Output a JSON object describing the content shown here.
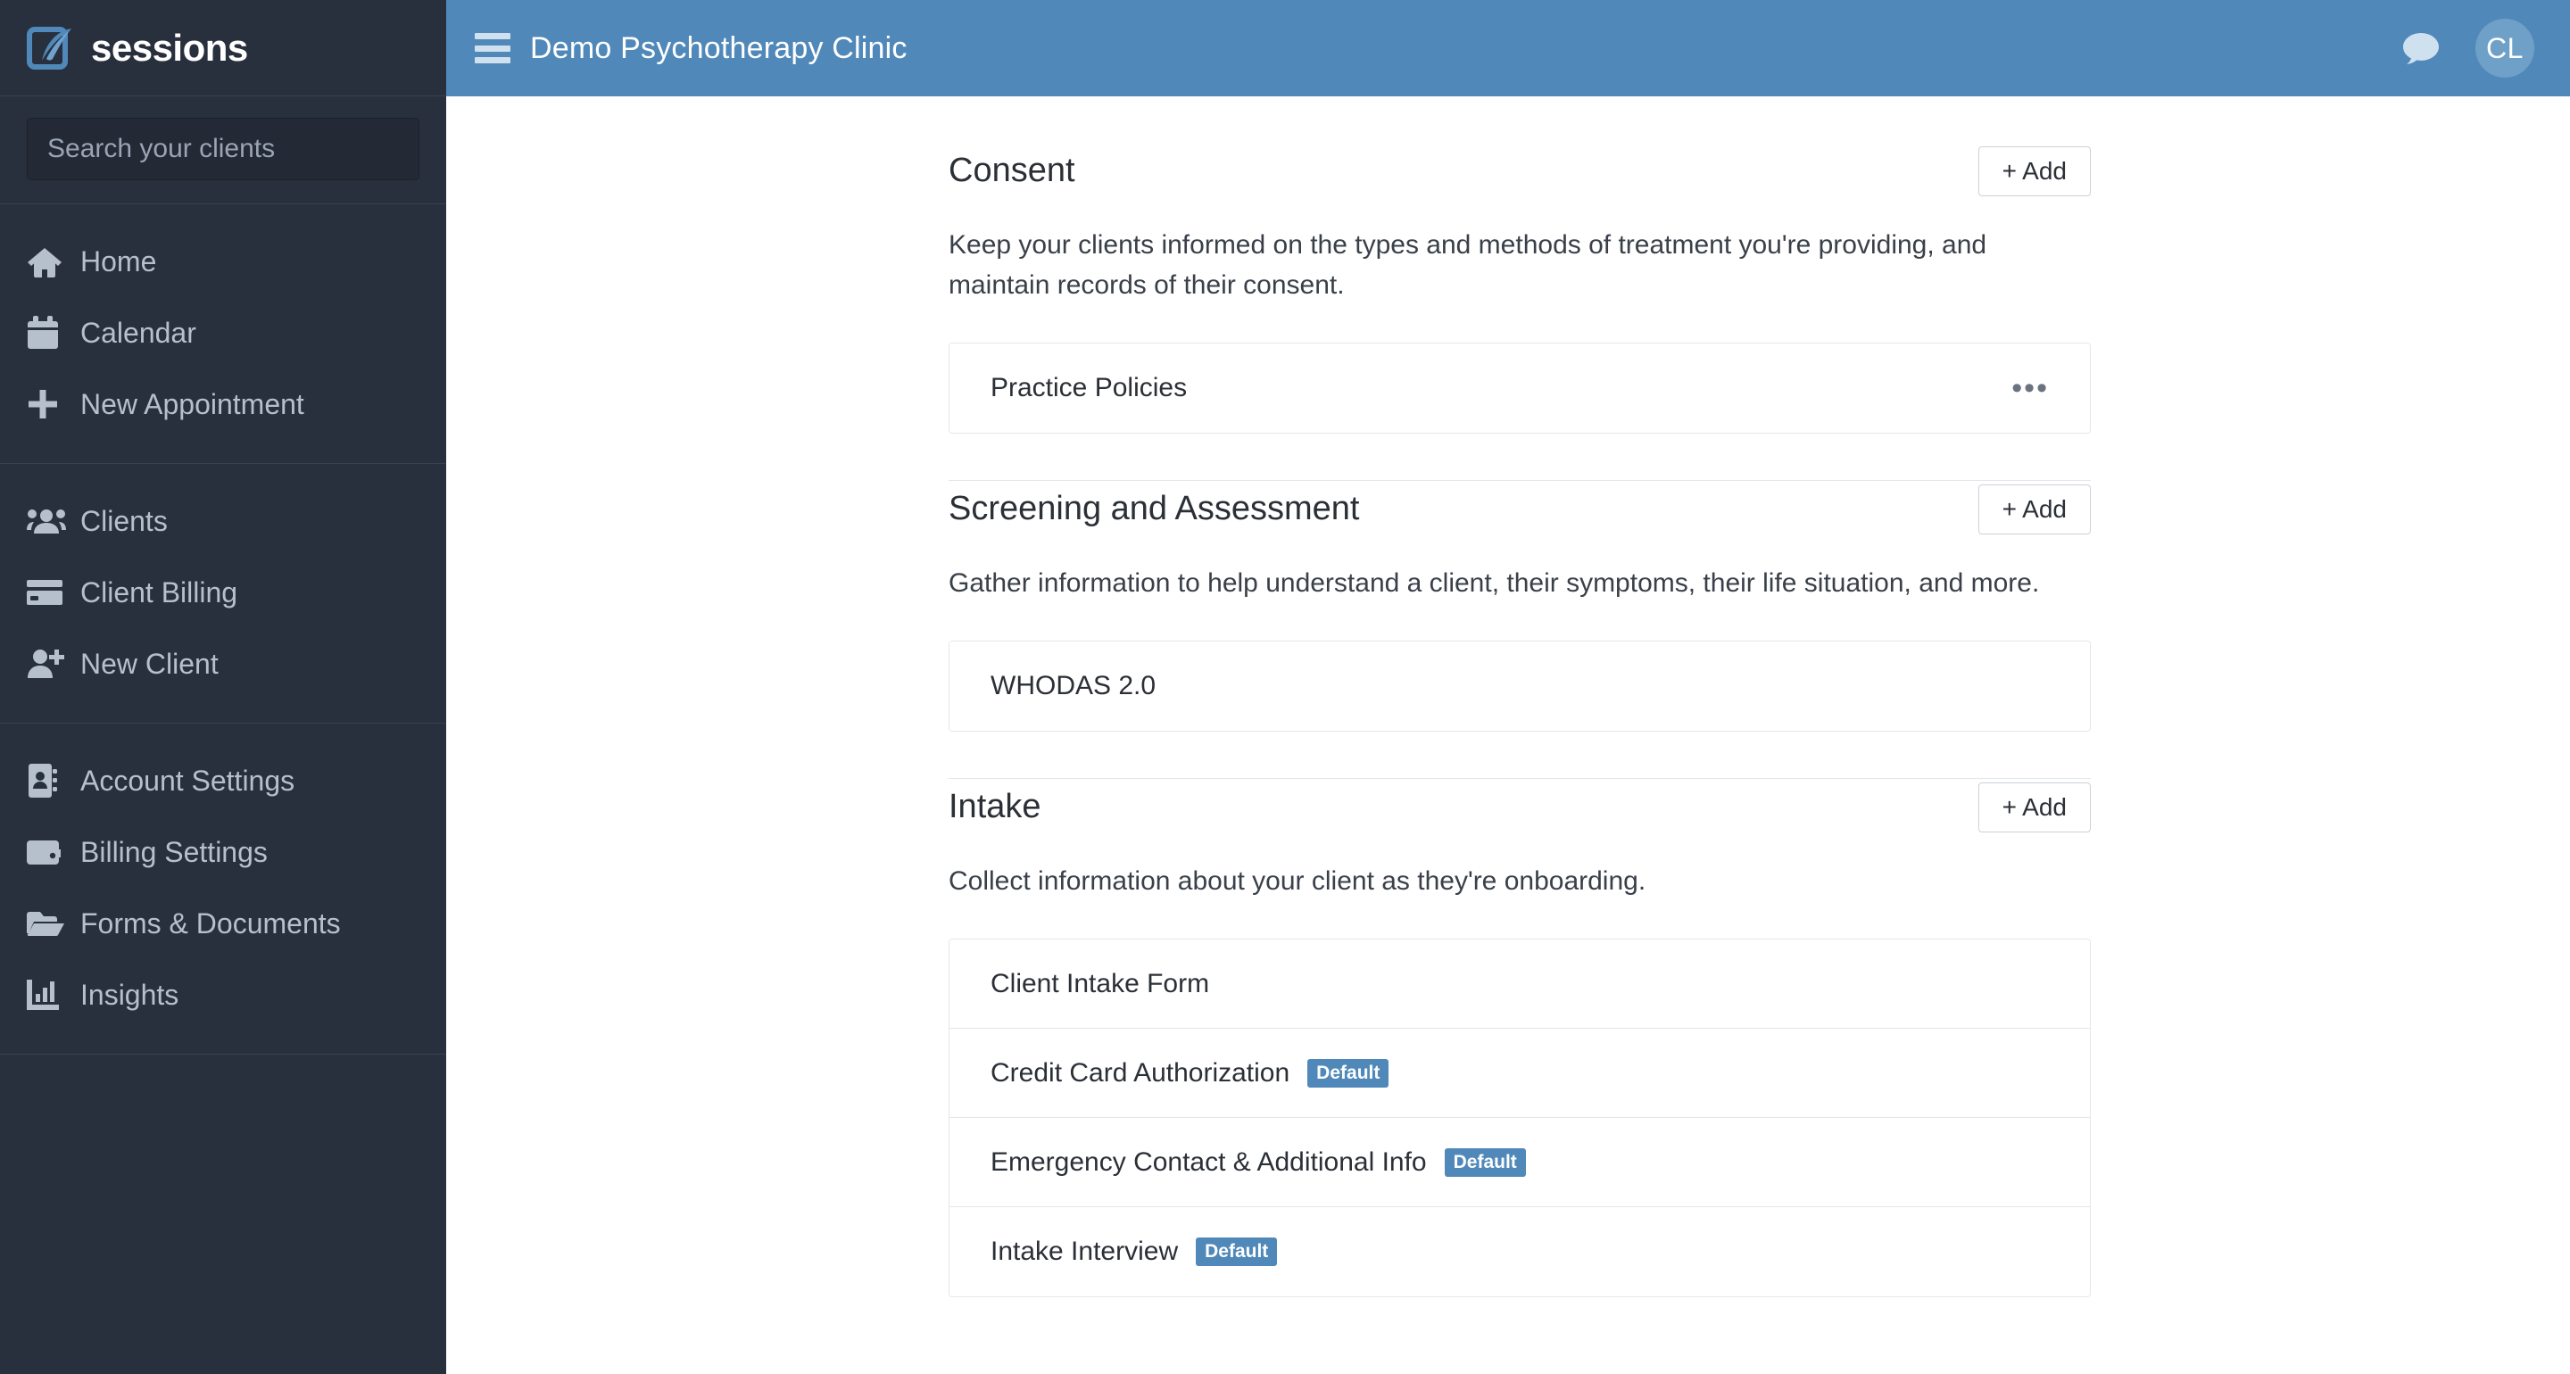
{
  "sidebar": {
    "brand": {
      "name": "sessions",
      "logo_icon": "quill-square-icon"
    },
    "search": {
      "placeholder": "Search your clients",
      "value": ""
    },
    "groups": [
      {
        "items": [
          {
            "label": "Home",
            "icon": "home-icon"
          },
          {
            "label": "Calendar",
            "icon": "calendar-icon"
          },
          {
            "label": "New Appointment",
            "icon": "plus-icon"
          }
        ]
      },
      {
        "items": [
          {
            "label": "Clients",
            "icon": "users-icon"
          },
          {
            "label": "Client Billing",
            "icon": "credit-card-icon"
          },
          {
            "label": "New Client",
            "icon": "user-plus-icon"
          }
        ]
      },
      {
        "items": [
          {
            "label": "Account Settings",
            "icon": "address-book-icon"
          },
          {
            "label": "Billing Settings",
            "icon": "wallet-icon"
          },
          {
            "label": "Forms & Documents",
            "icon": "folder-open-icon"
          },
          {
            "label": "Insights",
            "icon": "bar-chart-icon"
          }
        ]
      }
    ]
  },
  "topbar": {
    "menu_icon": "hamburger-icon",
    "title": "Demo Psychotherapy Clinic",
    "chat_icon": "chat-bubble-icon",
    "avatar_initials": "CL"
  },
  "sections": [
    {
      "title": "Consent",
      "add_label": "+ Add",
      "description": "Keep your clients informed on the types and methods of treatment you're providing, and maintain records of their consent.",
      "items": [
        {
          "label": "Practice Policies",
          "badge": "",
          "kebab": "•••"
        }
      ]
    },
    {
      "title": "Screening and Assessment",
      "add_label": "+ Add",
      "description": "Gather information to help understand a client, their symptoms, their life situation, and more.",
      "items": [
        {
          "label": "WHODAS 2.0",
          "badge": "",
          "kebab": ""
        }
      ]
    },
    {
      "title": "Intake",
      "add_label": "+ Add",
      "description": "Collect information about your client as they're onboarding.",
      "items": [
        {
          "label": "Client Intake Form",
          "badge": "",
          "kebab": ""
        },
        {
          "label": "Credit Card Authorization",
          "badge": "Default",
          "kebab": ""
        },
        {
          "label": "Emergency Contact & Additional Info",
          "badge": "Default",
          "kebab": ""
        },
        {
          "label": "Intake Interview",
          "badge": "Default",
          "kebab": ""
        }
      ]
    }
  ],
  "colors": {
    "sidebar_bg": "#29303d",
    "topbar_bg": "#5089b9",
    "accent": "#5089b9",
    "badge_bg": "#5089b9",
    "border": "#e4e6e9"
  }
}
